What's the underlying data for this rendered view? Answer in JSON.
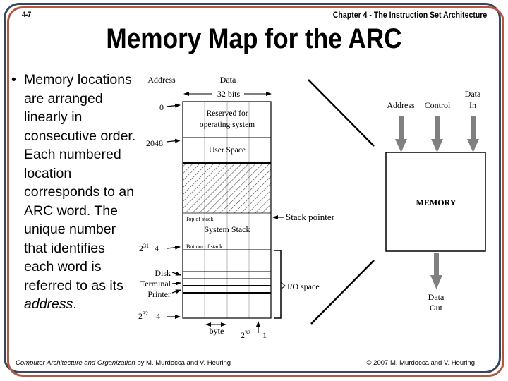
{
  "header": {
    "slide_number": "4-7",
    "chapter": "Chapter 4 - The Instruction Set Architecture",
    "title": "Memory Map for the ARC"
  },
  "bullet": {
    "marker": "•",
    "text_before_italic": "Memory locations are arranged linearly in consecutive order. Each numbered location corresponds to an ARC word. The unique number that identifies each word is referred to as its ",
    "italic": "address",
    "text_after_italic": "."
  },
  "memory_map": {
    "address_header": "Address",
    "data_header": "Data",
    "width_label": "32 bits",
    "addresses": {
      "zero": "0",
      "user_start": "2048",
      "stack_bottom_base": "2",
      "stack_bottom_exp": "31",
      "stack_bottom_rest": "4",
      "last_word_base": "2",
      "last_word_exp": "32",
      "last_word_rest": "– 4",
      "last_byte_base": "2",
      "last_byte_exp": "32",
      "last_byte_rest": "1"
    },
    "regions": {
      "reserved_line1": "Reserved for",
      "reserved_line2": "operating system",
      "user_space": "User Space",
      "top_of_stack": "Top of stack",
      "system_stack": "System Stack",
      "bottom_of_stack": "Bottom of stack"
    },
    "stack_pointer_label": "Stack pointer",
    "io_devices": [
      "Disk",
      "Terminal",
      "Printer"
    ],
    "io_space_label": "I/O space",
    "byte_label": "byte"
  },
  "memory_block": {
    "inputs": [
      {
        "line1": "",
        "line2": "Address"
      },
      {
        "line1": "",
        "line2": "Control"
      },
      {
        "line1": "Data",
        "line2": "In"
      }
    ],
    "label": "MEMORY",
    "output_line1": "Data",
    "output_line2": "Out"
  },
  "footer": {
    "book_title": "Computer Architecture and Organization",
    "book_authors": " by M. Murdocca and V. Heuring",
    "copyright": "© 2007 M. Murdocca and V. Heuring"
  },
  "colors": {
    "frame_outer": "#34495e",
    "frame_inner": "#b85540",
    "arrow_gray": "#808080"
  }
}
